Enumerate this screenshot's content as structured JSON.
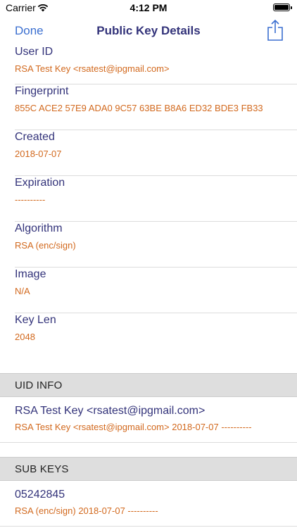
{
  "status_bar": {
    "carrier": "Carrier",
    "time": "4:12 PM"
  },
  "nav": {
    "done_label": "Done",
    "title": "Public Key Details",
    "share_icon": "share-icon"
  },
  "fields": [
    {
      "label": "User ID",
      "value": "RSA Test Key <rsatest@ipgmail.com>"
    },
    {
      "label": "Fingerprint",
      "value": "855C ACE2 57E9 ADA0 9C57 63BE B8A6 ED32 BDE3 FB33"
    },
    {
      "label": "Created",
      "value": "2018-07-07"
    },
    {
      "label": "Expiration",
      "value": "----------"
    },
    {
      "label": "Algorithm",
      "value": "RSA (enc/sign)"
    },
    {
      "label": "Image",
      "value": "N/A"
    },
    {
      "label": "Key Len",
      "value": "2048"
    }
  ],
  "uid_info": {
    "header": "UID INFO",
    "items": [
      {
        "label": "RSA Test Key <rsatest@ipgmail.com>",
        "value": "RSA Test Key <rsatest@ipgmail.com> 2018-07-07 ----------"
      }
    ]
  },
  "sub_keys": {
    "header": "SUB KEYS",
    "items": [
      {
        "label": "05242845",
        "value": "RSA (enc/sign) 2018-07-07 ----------"
      }
    ]
  },
  "colors": {
    "label": "#33337a",
    "value": "#d2691e",
    "accent": "#3b6fd0",
    "section_bg": "#dedede"
  }
}
